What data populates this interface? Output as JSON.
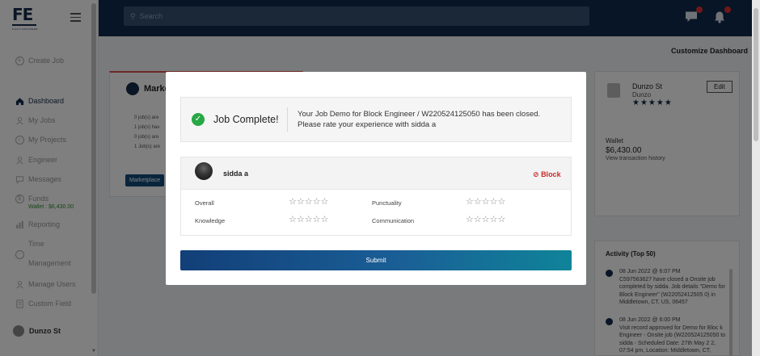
{
  "brand": {
    "logo": "FE",
    "tagline": "FIELD ENGINEER"
  },
  "sidebar": {
    "create_job": "Create Job",
    "items": [
      {
        "label": "Dashboard"
      },
      {
        "label": "My Jobs"
      },
      {
        "label": "My Projects"
      },
      {
        "label": "Engineer"
      },
      {
        "label": "Messages"
      },
      {
        "label": "Funds",
        "sub": "Wallet : $6,430.00"
      },
      {
        "label": "Reporting"
      },
      {
        "label": "Time"
      },
      {
        "label": "Management"
      },
      {
        "label": "Manage Users"
      },
      {
        "label": "Custom Field"
      }
    ],
    "user": "Dunzo St"
  },
  "topbar": {
    "search_placeholder": "Search",
    "messages_badge": "",
    "notifications_badge": ""
  },
  "dashboard": {
    "customize": "Customize Dashboard",
    "marketplace": {
      "title": "Marke",
      "lines": [
        "0 job(s) are",
        "1 job(s) hav",
        "0 job(s) are",
        "1 Job(s) are"
      ],
      "button": "Marketplace"
    },
    "profile": {
      "name": "Dunzo St",
      "company": "Dunzo",
      "stars": "★★★★★",
      "edit": "Edit"
    },
    "wallet": {
      "label": "Wallet",
      "amount": "$6,430.00",
      "link": "View transaction history"
    },
    "activity": {
      "title": "Activity (Top 50)",
      "items": [
        {
          "time": "08 Jun 2022 @ 6:07 PM",
          "text": "C597563627 have closed a Onsite job completed by sidda. Job details \"Demo for Block Engineer\" (W22052412505 0) in Middletown, CT, US, 06457"
        },
        {
          "time": "08 Jun 2022 @ 6:00 PM",
          "text": "Visit record approved for Demo for Bloc k Engineer - Onsite job (W220524125050 to sidda - Scheduled Date: 27th May 2 2, 07:54 pm, Location: Middletown, CT,"
        }
      ]
    }
  },
  "modal": {
    "title": "Job Complete!",
    "message_line1": "Your Job Demo for Block Engineer / W220524125050 has been closed.",
    "message_line2": "Please rate your experience with sidda a",
    "engineer": "sidda a",
    "block": "Block",
    "ratings": [
      {
        "label": "Overall",
        "stars": "☆☆☆☆☆"
      },
      {
        "label": "Punctuality",
        "stars": "☆☆☆☆☆"
      },
      {
        "label": "Knowledge",
        "stars": "☆☆☆☆☆"
      },
      {
        "label": "Communication",
        "stars": "☆☆☆☆☆"
      }
    ],
    "submit": "Submit"
  },
  "colors": {
    "navy": "#0e2a4d",
    "success": "#27a844",
    "danger": "#c92a2a",
    "wallet_green": "#2e8b2e"
  }
}
